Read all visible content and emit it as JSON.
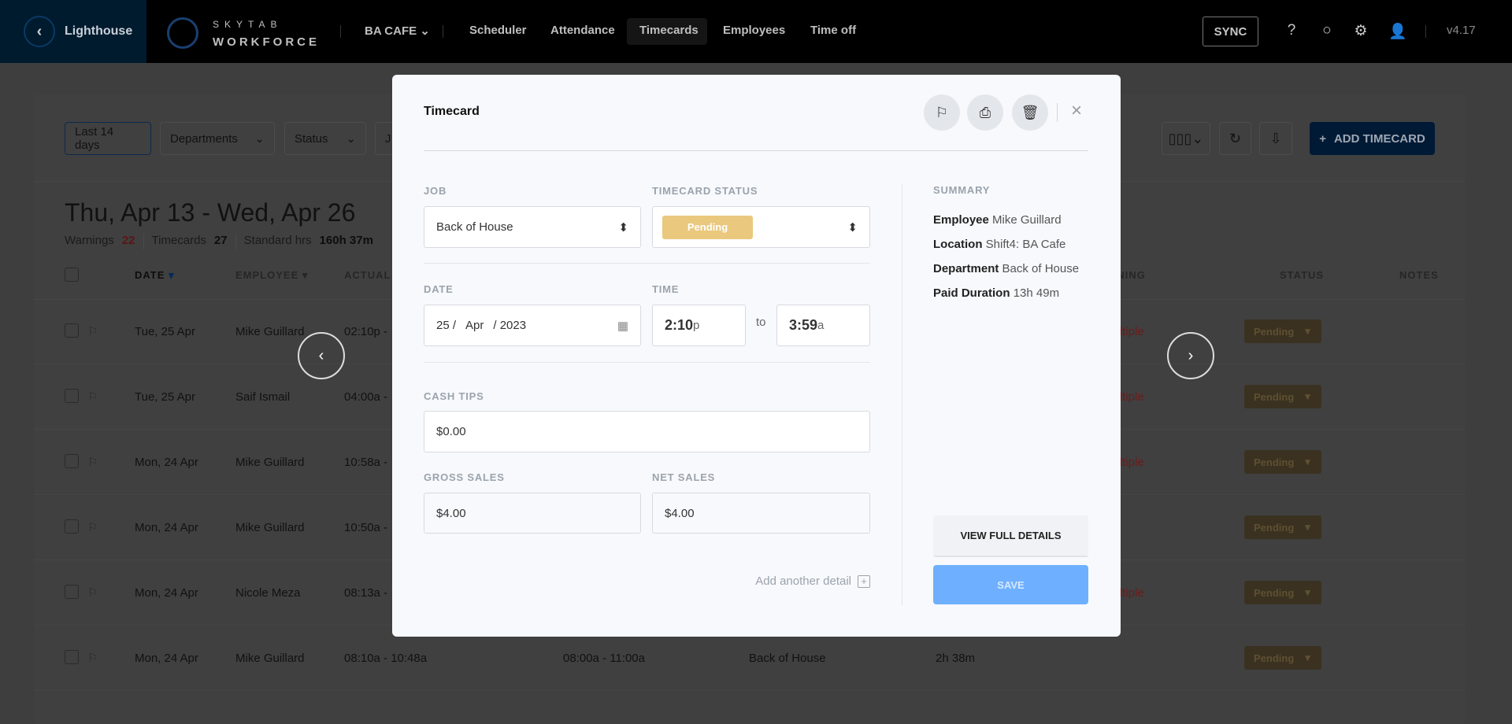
{
  "nav": {
    "back_label": "Lighthouse",
    "logo_top": "SKYTAB",
    "logo_bottom": "WORKFORCE",
    "location": "BA CAFE",
    "items": [
      "Scheduler",
      "Attendance",
      "Timecards",
      "Employees",
      "Time off"
    ],
    "active": "Timecards",
    "sync": "SYNC",
    "version": "v4.17"
  },
  "filters": {
    "range": "Last 14 days",
    "departments": "Departments",
    "status": "Status",
    "partial": "J",
    "add": "ADD TIMECARD"
  },
  "header": {
    "title": "Thu, Apr 13 - Wed, Apr 26",
    "warnings_label": "Warnings",
    "warnings": "22",
    "timecards_label": "Timecards",
    "timecards": "27",
    "std_label": "Standard hrs",
    "std": "160h 37m"
  },
  "columns": {
    "date": "DATE",
    "employee": "EMPLOYEE",
    "actual": "ACTUAL",
    "warning": "WARNING",
    "status": "STATUS",
    "notes": "NOTES"
  },
  "rows": [
    {
      "date": "Tue, 25 Apr",
      "employee": "Mike Guillard",
      "actual": "02:10p -",
      "scheduled": "",
      "job": "",
      "duration": "",
      "warning": "Multiple",
      "status": "Pending"
    },
    {
      "date": "Tue, 25 Apr",
      "employee": "Saif Ismail",
      "actual": "04:00a -",
      "scheduled": "",
      "job": "",
      "duration": "",
      "warning": "Multiple",
      "status": "Pending"
    },
    {
      "date": "Mon, 24 Apr",
      "employee": "Mike Guillard",
      "actual": "10:58a -",
      "scheduled": "",
      "job": "",
      "duration": "",
      "warning": "Multiple",
      "status": "Pending"
    },
    {
      "date": "Mon, 24 Apr",
      "employee": "Mike Guillard",
      "actual": "10:50a -",
      "scheduled": "",
      "job": "",
      "duration": "",
      "warning": "",
      "status": "Pending"
    },
    {
      "date": "Mon, 24 Apr",
      "employee": "Nicole Meza",
      "actual": "08:13a -",
      "scheduled": "",
      "job": "",
      "duration": "",
      "warning": "Multiple",
      "status": "Pending"
    },
    {
      "date": "Mon, 24 Apr",
      "employee": "Mike Guillard",
      "actual": "08:10a - 10:48a",
      "scheduled": "08:00a - 11:00a",
      "job": "Back of House",
      "duration": "2h 38m",
      "warning": "",
      "status": "Pending"
    }
  ],
  "modal": {
    "title": "Timecard",
    "job_label": "JOB",
    "job": "Back of House",
    "status_label": "TIMECARD STATUS",
    "status": "Pending",
    "date_label": "DATE",
    "date_day": "25 /",
    "date_month": "Apr",
    "date_year": "/ 2023",
    "time_label": "TIME",
    "time_start": "2:10",
    "time_start_suffix": "p",
    "to": "to",
    "time_end": "3:59",
    "time_end_suffix": "a",
    "cash_tips_label": "CASH TIPS",
    "cash_tips": "$0.00",
    "gross_label": "GROSS SALES",
    "gross": "$4.00",
    "net_label": "NET SALES",
    "net": "$4.00",
    "add_detail": "Add another detail",
    "summary": {
      "label": "SUMMARY",
      "employee_k": "Employee",
      "employee_v": "Mike Guillard",
      "location_k": "Location",
      "location_v": "Shift4: BA Cafe",
      "department_k": "Department",
      "department_v": "Back of House",
      "paid_k": "Paid Duration",
      "paid_v": "13h 49m"
    },
    "view_full": "VIEW FULL DETAILS",
    "save": "SAVE"
  },
  "colors": {
    "primary": "#0068d9",
    "pending": "#eac87e",
    "warning": "#c0392b",
    "save_disabled": "#6eb0ff"
  }
}
